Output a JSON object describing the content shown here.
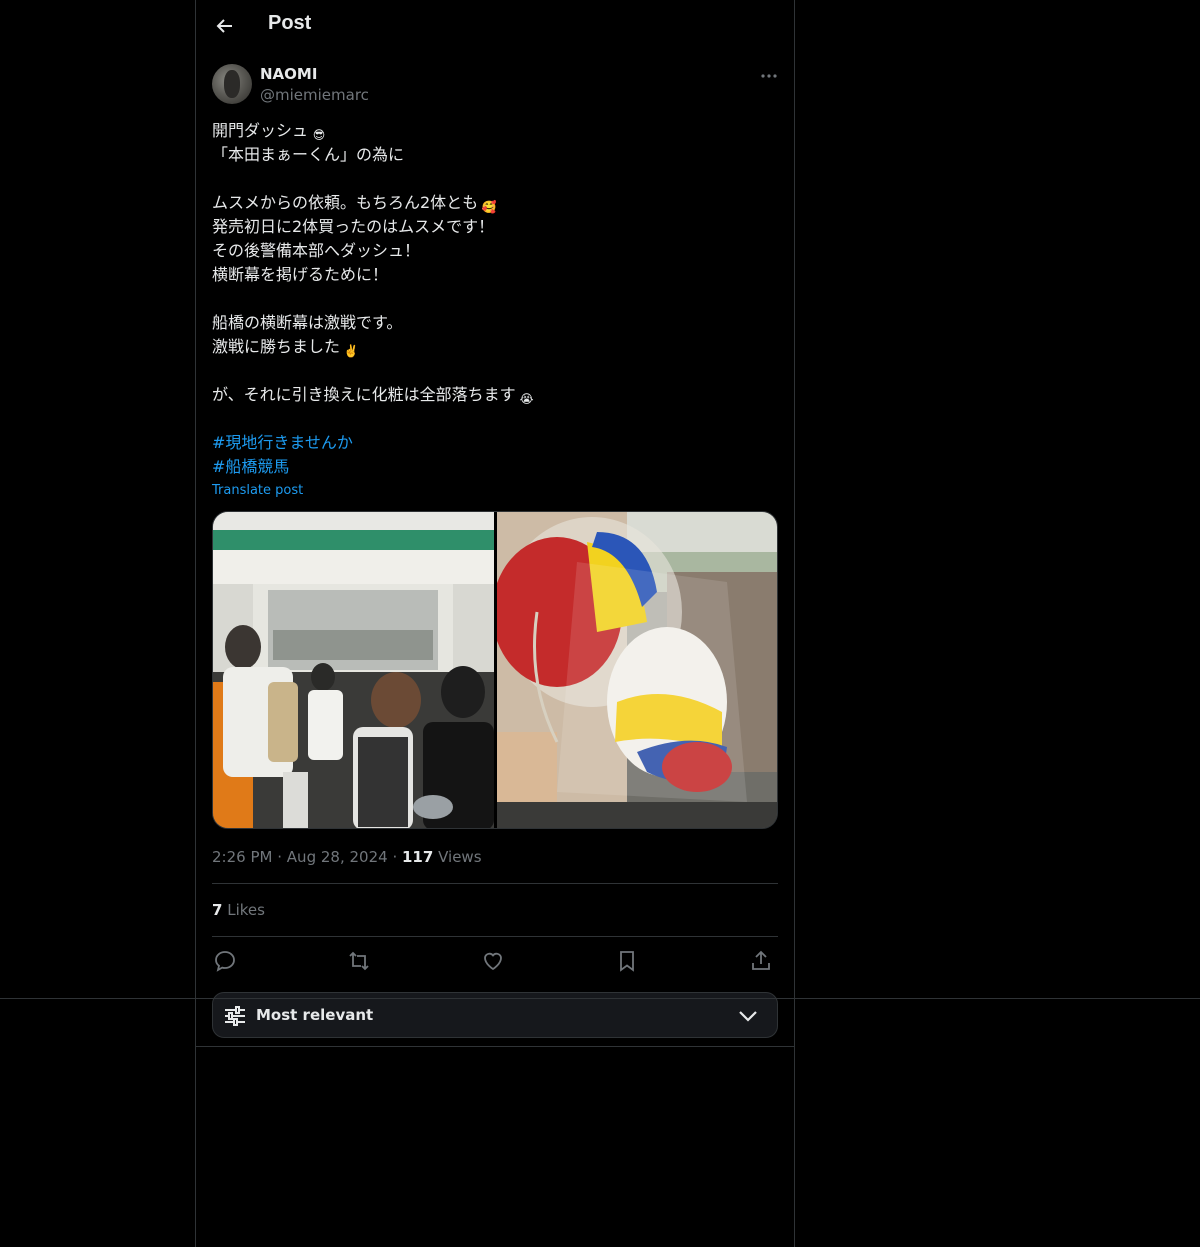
{
  "header": {
    "title": "Post",
    "back_icon": "arrow-left-icon"
  },
  "author": {
    "name": "NAOMI",
    "handle": "@miemiemarc"
  },
  "post": {
    "lines": [
      {
        "text": "開門ダッシュ",
        "emoji": "😎",
        "emoji_color": "#f4b400"
      },
      {
        "text": "「本田まぁーくん」の為に"
      },
      {
        "text": ""
      },
      {
        "text": "ムスメからの依頼。もちろん2体とも",
        "emoji": "🥰",
        "emoji_color": "#f5a623"
      },
      {
        "text": "発売初日に2体買ったのはムスメです！"
      },
      {
        "text": "その後警備本部へダッシュ！"
      },
      {
        "text": "横断幕を掲げるために！"
      },
      {
        "text": ""
      },
      {
        "text": "船橋の横断幕は激戦です。"
      },
      {
        "text": "激戦に勝ちました",
        "emoji": "✌️",
        "emoji_color": "#f6c343"
      },
      {
        "text": ""
      },
      {
        "text": "が、それに引き換えに化粧は全部落ちます",
        "emoji": "😭",
        "emoji_color": "#f4c025"
      },
      {
        "text": ""
      }
    ],
    "hashtags": [
      "#現地行きませんか",
      "#船橋競馬"
    ],
    "translate_label": "Translate post"
  },
  "meta": {
    "time": "2:26 PM",
    "dot1": "·",
    "date": "Aug 28, 2024",
    "dot2": "·",
    "views_count": "117",
    "views_label": "Views"
  },
  "likes": {
    "count": "7",
    "label": "Likes"
  },
  "actions": [
    "reply-icon",
    "repost-icon",
    "like-icon",
    "bookmark-icon",
    "share-icon"
  ],
  "sort": {
    "label": "Most relevant"
  },
  "colors": {
    "accent": "#1d9bf0",
    "border": "#2f3336",
    "muted": "#71767b",
    "text": "#e7e9ea"
  }
}
